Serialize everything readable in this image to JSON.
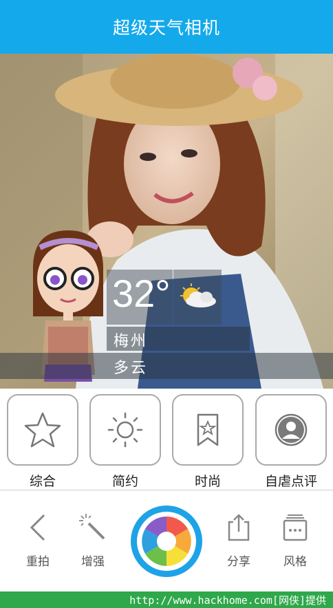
{
  "app": {
    "title": "超级天气相机"
  },
  "weather": {
    "temperature": "32°",
    "city": "梅州",
    "condition": "多云",
    "icon": "partly-cloudy-icon"
  },
  "modes": [
    {
      "label": "综合",
      "icon": "star-icon"
    },
    {
      "label": "简约",
      "icon": "sun-icon"
    },
    {
      "label": "时尚",
      "icon": "bookmark-star-icon"
    },
    {
      "label": "自虐点评",
      "icon": "person-icon"
    }
  ],
  "toolbar": {
    "retake_label": "重拍",
    "enhance_label": "增强",
    "share_label": "分享",
    "style_label": "风格",
    "shutter_icon": "camera-aperture-icon"
  },
  "footer": {
    "text": "http://www.hackhome.com[网侠]提供"
  },
  "colors": {
    "accent": "#14a9eb",
    "footer": "#2ea84a"
  }
}
